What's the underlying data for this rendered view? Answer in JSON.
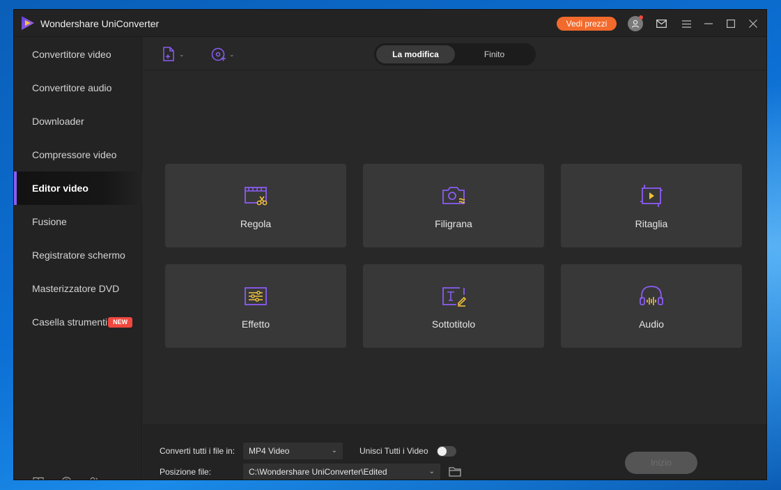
{
  "window": {
    "title": "Wondershare UniConverter",
    "pricing_label": "Vedi prezzi"
  },
  "sidebar": {
    "items": [
      {
        "label": "Convertitore video",
        "active": false
      },
      {
        "label": "Convertitore audio",
        "active": false
      },
      {
        "label": "Downloader",
        "active": false
      },
      {
        "label": "Compressore video",
        "active": false
      },
      {
        "label": "Editor video",
        "active": true
      },
      {
        "label": "Fusione",
        "active": false
      },
      {
        "label": "Registratore schermo",
        "active": false
      },
      {
        "label": "Masterizzatore DVD",
        "active": false
      },
      {
        "label": "Casella strumenti",
        "active": false,
        "badge": "NEW"
      }
    ],
    "bottom_icons": [
      "book-icon",
      "help-icon",
      "users-icon"
    ]
  },
  "toolbar": {
    "tabs": [
      {
        "label": "La modifica",
        "selected": true
      },
      {
        "label": "Finito",
        "selected": false
      }
    ]
  },
  "tools": [
    {
      "label": "Regola",
      "icon": "trim-icon"
    },
    {
      "label": "Filigrana",
      "icon": "watermark-icon"
    },
    {
      "label": "Ritaglia",
      "icon": "crop-icon"
    },
    {
      "label": "Effetto",
      "icon": "effect-icon"
    },
    {
      "label": "Sottotitolo",
      "icon": "subtitle-icon"
    },
    {
      "label": "Audio",
      "icon": "audio-icon"
    }
  ],
  "footer": {
    "convert_label": "Converti tutti i file in:",
    "format_value": "MP4 Video",
    "merge_label": "Unisci Tutti i Video",
    "merge_enabled": false,
    "location_label": "Posizione file:",
    "location_value": "C:\\Wondershare UniConverter\\Edited",
    "start_label": "Inizio"
  },
  "colors": {
    "accent": "#8b5cf6",
    "icon_yellow": "#f2c23a",
    "pricing": "#f26a2c",
    "badge": "#f0483e"
  }
}
